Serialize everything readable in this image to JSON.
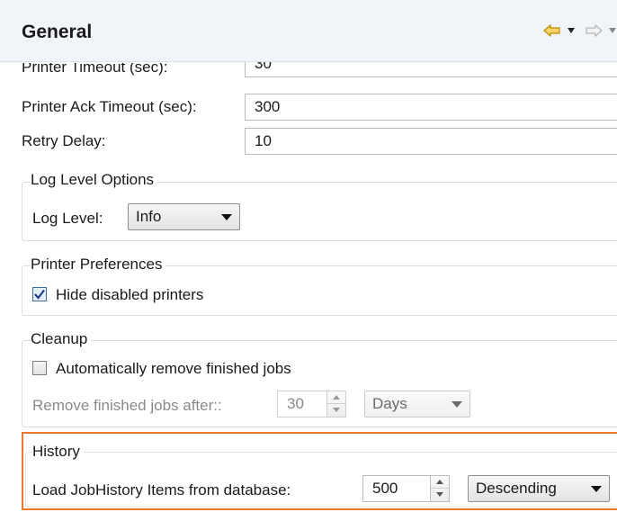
{
  "header": {
    "title": "General",
    "icons": {
      "back": "back-arrow-icon",
      "back_menu": "chevron-down-icon",
      "forward": "forward-arrow-icon",
      "forward_menu": "chevron-down-icon"
    },
    "accent_color": "#e8b21a"
  },
  "fields": {
    "printer_timeout_label": "Printer Timeout (sec):",
    "printer_timeout_value": "30",
    "printer_ack_timeout_label": "Printer Ack Timeout (sec):",
    "printer_ack_timeout_value": "300",
    "retry_delay_label": "Retry Delay:",
    "retry_delay_value": "10"
  },
  "log_level_options": {
    "title": "Log Level Options",
    "log_level_label": "Log Level:",
    "log_level_value": "Info"
  },
  "printer_preferences": {
    "title": "Printer Preferences",
    "hide_disabled_label": "Hide disabled printers",
    "hide_disabled_checked": true
  },
  "cleanup": {
    "title": "Cleanup",
    "auto_remove_label": "Automatically remove finished jobs",
    "auto_remove_checked": false,
    "remove_after_label": "Remove finished jobs after::",
    "remove_after_value": "30",
    "remove_after_unit": "Days"
  },
  "history": {
    "title": "History",
    "load_label": "Load JobHistory Items from database:",
    "load_value": "500",
    "order_value": "Descending",
    "highlight_color": "#f0782a"
  }
}
